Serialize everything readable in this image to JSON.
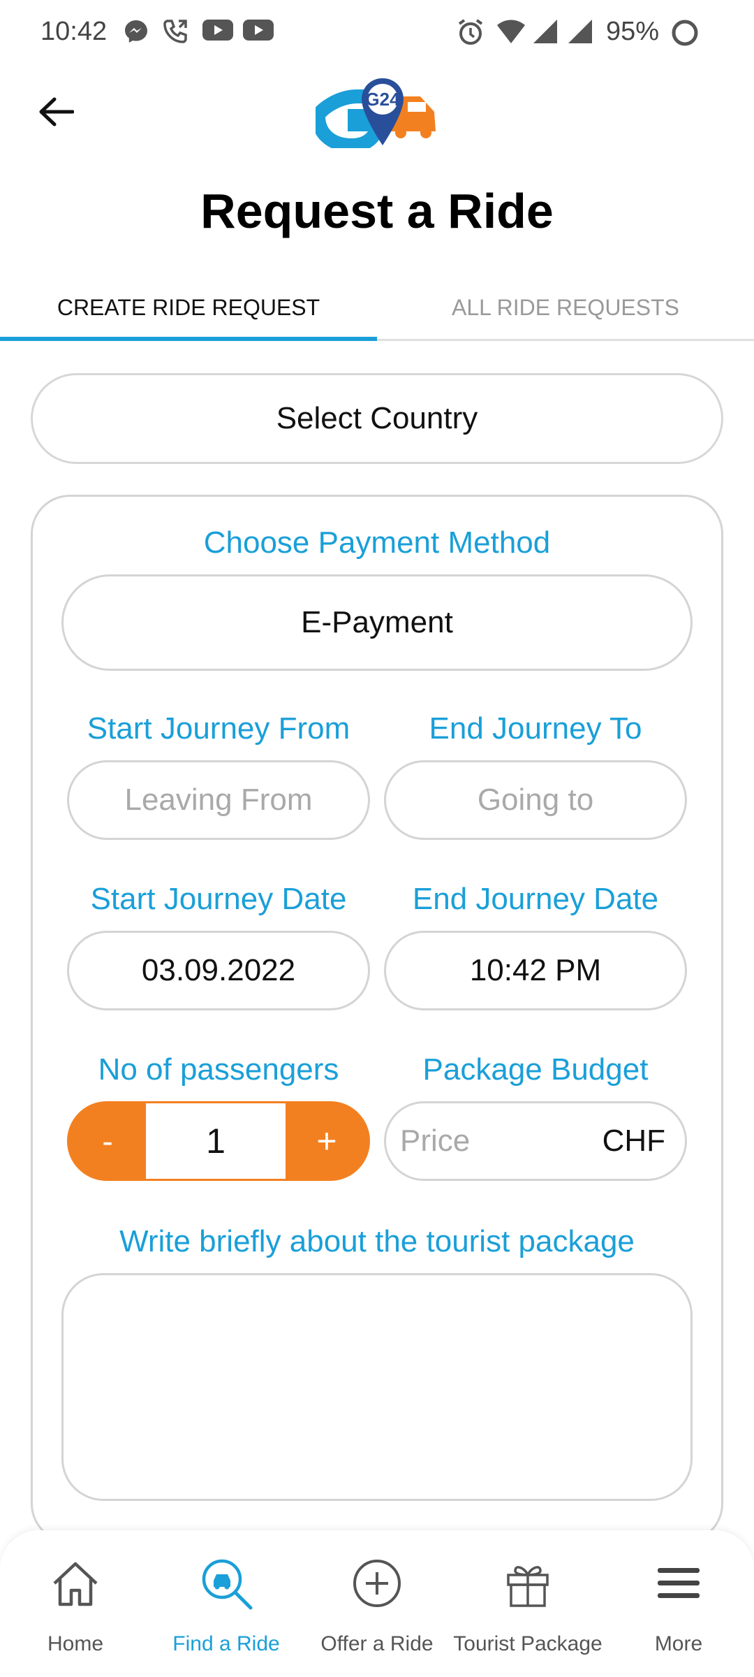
{
  "status_bar": {
    "time": "10:42",
    "battery": "95%",
    "icons": [
      "messenger-icon",
      "phone-icon",
      "youtube-icon",
      "youtube-icon",
      "alarm-icon",
      "wifi-icon",
      "signal-icon",
      "signal-icon",
      "battery-icon"
    ]
  },
  "header": {
    "title": "Request a Ride",
    "logo_text": "G24"
  },
  "tabs": [
    {
      "label": "CREATE RIDE REQUEST",
      "active": true
    },
    {
      "label": "ALL RIDE REQUESTS",
      "active": false
    }
  ],
  "form": {
    "country": "Select Country",
    "payment_label": "Choose Payment Method",
    "payment_value": "E-Payment",
    "start_from_label": "Start Journey From",
    "start_from_placeholder": "Leaving From",
    "end_to_label": "End Journey To",
    "end_to_placeholder": "Going to",
    "start_date_label": "Start Journey Date",
    "start_date_value": "03.09.2022",
    "end_date_label": "End Journey Date",
    "end_date_value": "10:42 PM",
    "passengers_label": "No of passengers",
    "passengers_minus": "-",
    "passengers_value": "1",
    "passengers_plus": "+",
    "budget_label": "Package Budget",
    "budget_placeholder": "Price",
    "budget_currency": "CHF",
    "description_label": "Write briefly about the tourist package"
  },
  "bottom_nav": [
    {
      "label": "Home",
      "icon": "home-icon",
      "active": false
    },
    {
      "label": "Find a Ride",
      "icon": "car-search-icon",
      "active": true
    },
    {
      "label": "Offer a Ride",
      "icon": "plus-circle-icon",
      "active": false
    },
    {
      "label": "Tourist Package",
      "icon": "gift-icon",
      "active": false
    },
    {
      "label": "More",
      "icon": "menu-icon",
      "active": false
    }
  ],
  "colors": {
    "accent": "#1a9fd8",
    "orange": "#f38020",
    "border": "#d4d4d4"
  }
}
